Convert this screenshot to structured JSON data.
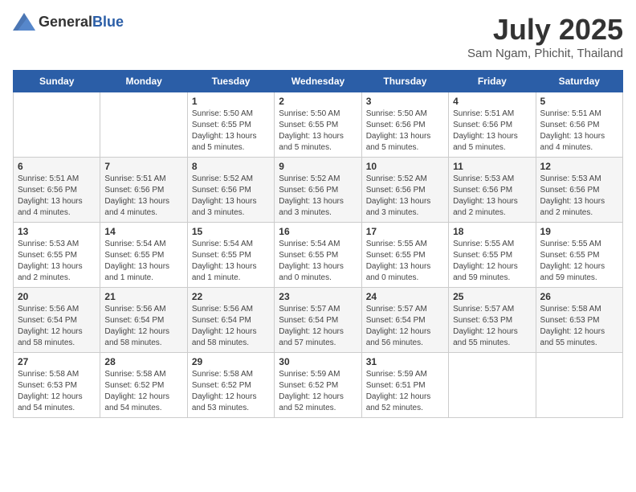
{
  "header": {
    "logo": {
      "general": "General",
      "blue": "Blue"
    },
    "title": "July 2025",
    "location": "Sam Ngam, Phichit, Thailand"
  },
  "weekdays": [
    "Sunday",
    "Monday",
    "Tuesday",
    "Wednesday",
    "Thursday",
    "Friday",
    "Saturday"
  ],
  "weeks": [
    [
      {
        "day": "",
        "sunrise": "",
        "sunset": "",
        "daylight": ""
      },
      {
        "day": "",
        "sunrise": "",
        "sunset": "",
        "daylight": ""
      },
      {
        "day": "1",
        "sunrise": "Sunrise: 5:50 AM",
        "sunset": "Sunset: 6:55 PM",
        "daylight": "Daylight: 13 hours and 5 minutes."
      },
      {
        "day": "2",
        "sunrise": "Sunrise: 5:50 AM",
        "sunset": "Sunset: 6:55 PM",
        "daylight": "Daylight: 13 hours and 5 minutes."
      },
      {
        "day": "3",
        "sunrise": "Sunrise: 5:50 AM",
        "sunset": "Sunset: 6:56 PM",
        "daylight": "Daylight: 13 hours and 5 minutes."
      },
      {
        "day": "4",
        "sunrise": "Sunrise: 5:51 AM",
        "sunset": "Sunset: 6:56 PM",
        "daylight": "Daylight: 13 hours and 5 minutes."
      },
      {
        "day": "5",
        "sunrise": "Sunrise: 5:51 AM",
        "sunset": "Sunset: 6:56 PM",
        "daylight": "Daylight: 13 hours and 4 minutes."
      }
    ],
    [
      {
        "day": "6",
        "sunrise": "Sunrise: 5:51 AM",
        "sunset": "Sunset: 6:56 PM",
        "daylight": "Daylight: 13 hours and 4 minutes."
      },
      {
        "day": "7",
        "sunrise": "Sunrise: 5:51 AM",
        "sunset": "Sunset: 6:56 PM",
        "daylight": "Daylight: 13 hours and 4 minutes."
      },
      {
        "day": "8",
        "sunrise": "Sunrise: 5:52 AM",
        "sunset": "Sunset: 6:56 PM",
        "daylight": "Daylight: 13 hours and 3 minutes."
      },
      {
        "day": "9",
        "sunrise": "Sunrise: 5:52 AM",
        "sunset": "Sunset: 6:56 PM",
        "daylight": "Daylight: 13 hours and 3 minutes."
      },
      {
        "day": "10",
        "sunrise": "Sunrise: 5:52 AM",
        "sunset": "Sunset: 6:56 PM",
        "daylight": "Daylight: 13 hours and 3 minutes."
      },
      {
        "day": "11",
        "sunrise": "Sunrise: 5:53 AM",
        "sunset": "Sunset: 6:56 PM",
        "daylight": "Daylight: 13 hours and 2 minutes."
      },
      {
        "day": "12",
        "sunrise": "Sunrise: 5:53 AM",
        "sunset": "Sunset: 6:56 PM",
        "daylight": "Daylight: 13 hours and 2 minutes."
      }
    ],
    [
      {
        "day": "13",
        "sunrise": "Sunrise: 5:53 AM",
        "sunset": "Sunset: 6:55 PM",
        "daylight": "Daylight: 13 hours and 2 minutes."
      },
      {
        "day": "14",
        "sunrise": "Sunrise: 5:54 AM",
        "sunset": "Sunset: 6:55 PM",
        "daylight": "Daylight: 13 hours and 1 minute."
      },
      {
        "day": "15",
        "sunrise": "Sunrise: 5:54 AM",
        "sunset": "Sunset: 6:55 PM",
        "daylight": "Daylight: 13 hours and 1 minute."
      },
      {
        "day": "16",
        "sunrise": "Sunrise: 5:54 AM",
        "sunset": "Sunset: 6:55 PM",
        "daylight": "Daylight: 13 hours and 0 minutes."
      },
      {
        "day": "17",
        "sunrise": "Sunrise: 5:55 AM",
        "sunset": "Sunset: 6:55 PM",
        "daylight": "Daylight: 13 hours and 0 minutes."
      },
      {
        "day": "18",
        "sunrise": "Sunrise: 5:55 AM",
        "sunset": "Sunset: 6:55 PM",
        "daylight": "Daylight: 12 hours and 59 minutes."
      },
      {
        "day": "19",
        "sunrise": "Sunrise: 5:55 AM",
        "sunset": "Sunset: 6:55 PM",
        "daylight": "Daylight: 12 hours and 59 minutes."
      }
    ],
    [
      {
        "day": "20",
        "sunrise": "Sunrise: 5:56 AM",
        "sunset": "Sunset: 6:54 PM",
        "daylight": "Daylight: 12 hours and 58 minutes."
      },
      {
        "day": "21",
        "sunrise": "Sunrise: 5:56 AM",
        "sunset": "Sunset: 6:54 PM",
        "daylight": "Daylight: 12 hours and 58 minutes."
      },
      {
        "day": "22",
        "sunrise": "Sunrise: 5:56 AM",
        "sunset": "Sunset: 6:54 PM",
        "daylight": "Daylight: 12 hours and 58 minutes."
      },
      {
        "day": "23",
        "sunrise": "Sunrise: 5:57 AM",
        "sunset": "Sunset: 6:54 PM",
        "daylight": "Daylight: 12 hours and 57 minutes."
      },
      {
        "day": "24",
        "sunrise": "Sunrise: 5:57 AM",
        "sunset": "Sunset: 6:54 PM",
        "daylight": "Daylight: 12 hours and 56 minutes."
      },
      {
        "day": "25",
        "sunrise": "Sunrise: 5:57 AM",
        "sunset": "Sunset: 6:53 PM",
        "daylight": "Daylight: 12 hours and 55 minutes."
      },
      {
        "day": "26",
        "sunrise": "Sunrise: 5:58 AM",
        "sunset": "Sunset: 6:53 PM",
        "daylight": "Daylight: 12 hours and 55 minutes."
      }
    ],
    [
      {
        "day": "27",
        "sunrise": "Sunrise: 5:58 AM",
        "sunset": "Sunset: 6:53 PM",
        "daylight": "Daylight: 12 hours and 54 minutes."
      },
      {
        "day": "28",
        "sunrise": "Sunrise: 5:58 AM",
        "sunset": "Sunset: 6:52 PM",
        "daylight": "Daylight: 12 hours and 54 minutes."
      },
      {
        "day": "29",
        "sunrise": "Sunrise: 5:58 AM",
        "sunset": "Sunset: 6:52 PM",
        "daylight": "Daylight: 12 hours and 53 minutes."
      },
      {
        "day": "30",
        "sunrise": "Sunrise: 5:59 AM",
        "sunset": "Sunset: 6:52 PM",
        "daylight": "Daylight: 12 hours and 52 minutes."
      },
      {
        "day": "31",
        "sunrise": "Sunrise: 5:59 AM",
        "sunset": "Sunset: 6:51 PM",
        "daylight": "Daylight: 12 hours and 52 minutes."
      },
      {
        "day": "",
        "sunrise": "",
        "sunset": "",
        "daylight": ""
      },
      {
        "day": "",
        "sunrise": "",
        "sunset": "",
        "daylight": ""
      }
    ]
  ]
}
